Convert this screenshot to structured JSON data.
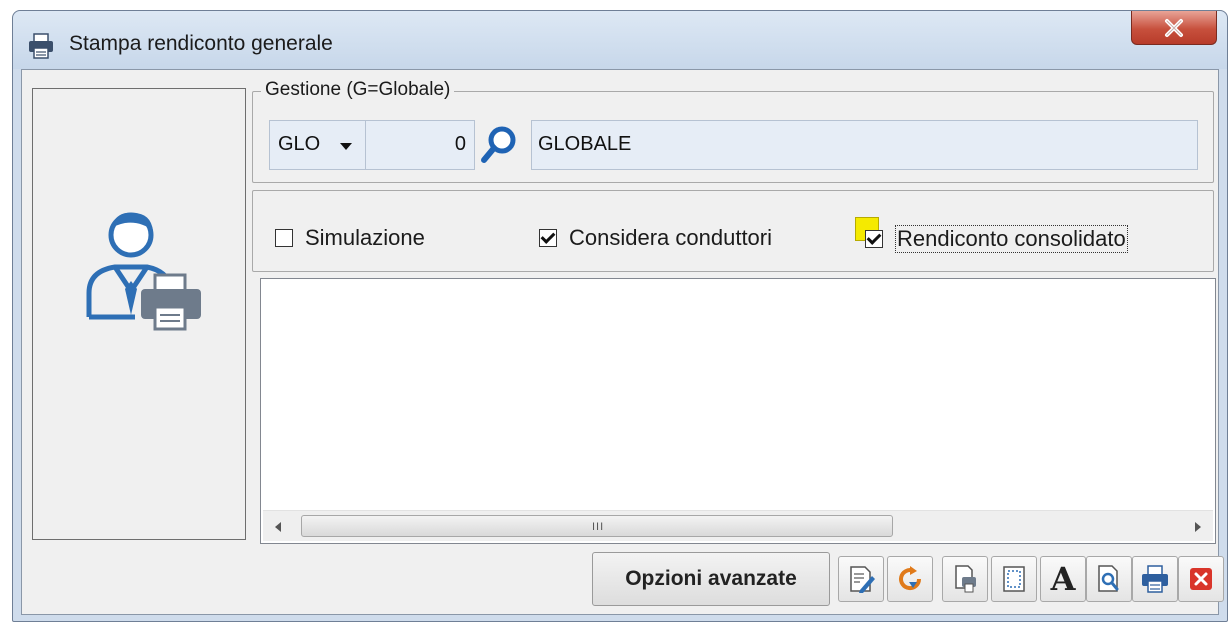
{
  "window": {
    "title": "Stampa rendiconto generale",
    "close_label": "X"
  },
  "gestione": {
    "legend": "Gestione (G=Globale)",
    "type_value": "GLO",
    "number_value": "0",
    "description_value": "GLOBALE"
  },
  "options": {
    "simulazione": {
      "label": "Simulazione",
      "checked": false
    },
    "considera_conduttori": {
      "label": "Considera conduttori",
      "checked": true
    },
    "rendiconto_consolidato": {
      "label": "Rendiconto consolidato",
      "checked": true
    }
  },
  "scrollbar": {
    "grip": "III"
  },
  "footer": {
    "advanced_label": "Opzioni avanzate",
    "font_button_label": "A"
  },
  "colors": {
    "window_frame": "#cfdcec",
    "close_red": "#c7503d",
    "icon_blue": "#2e6fb5",
    "focus_yellow": "#f5ea00"
  }
}
